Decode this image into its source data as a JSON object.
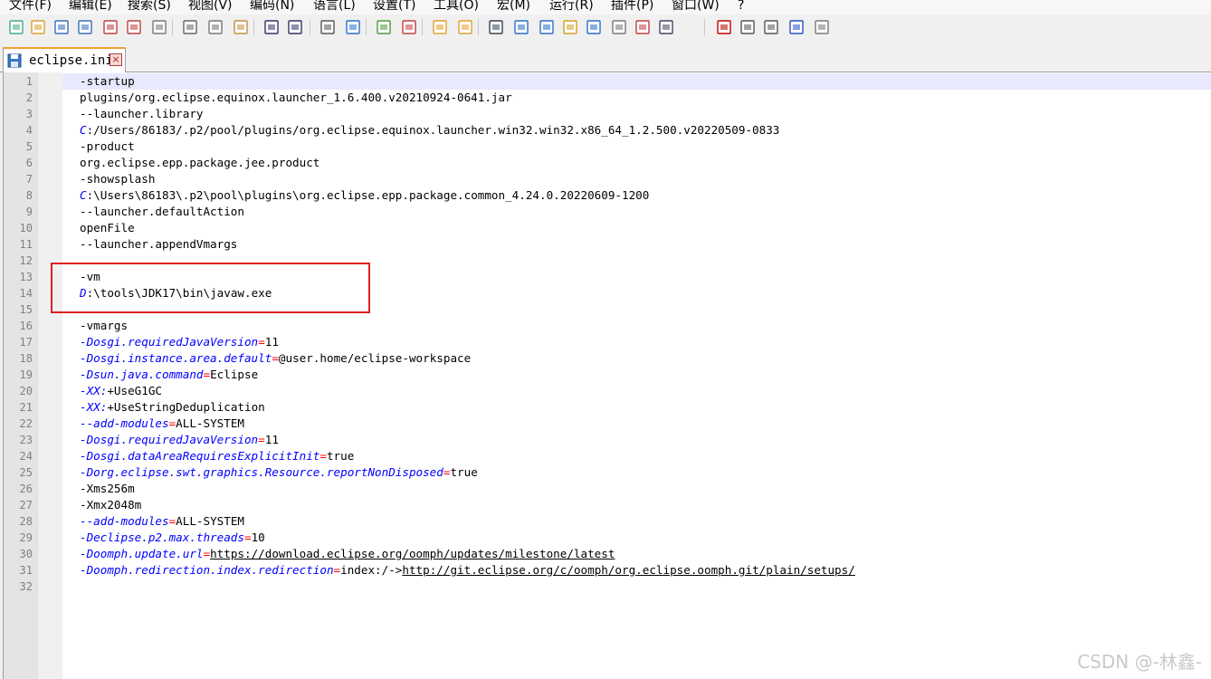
{
  "menu": [
    "文件(F)",
    "编辑(E)",
    "搜索(S)",
    "视图(V)",
    "编码(N)",
    "语言(L)",
    "设置(T)",
    "工具(O)",
    "宏(M)",
    "运行(R)",
    "插件(P)",
    "窗口(W)",
    "?"
  ],
  "toolbar": {
    "icons": [
      "new-file-icon",
      "open-file-icon",
      "save-icon",
      "save-all-icon",
      "close-icon",
      "close-all-icon",
      "print-icon",
      "cut-icon",
      "copy-icon",
      "paste-icon",
      "undo-icon",
      "redo-icon",
      "find-icon",
      "replace-icon",
      "zoom-in-icon",
      "zoom-out-icon",
      "sync-vertical-icon",
      "sync-horizontal-icon",
      "word-wrap-icon",
      "show-all-chars-icon",
      "indent-guide-icon",
      "user-language-icon",
      "document-map-icon",
      "function-list-icon",
      "folder-workspace-icon",
      "monitor-icon",
      "record-macro-icon",
      "stop-record-icon",
      "play-macro-icon",
      "run-macro-multiple-icon",
      "save-macro-icon"
    ]
  },
  "tab": {
    "label": "eclipse.ini",
    "close": "×"
  },
  "lines": [
    [
      {
        "t": "-startup"
      }
    ],
    [
      {
        "t": "plugins/org.eclipse.equinox.launcher_1.6.400.v20210924-0641.jar"
      }
    ],
    [
      {
        "t": "--launcher.library"
      }
    ],
    [
      {
        "t": "C",
        "s": "drv"
      },
      {
        "t": ":/Users/86183/.p2/pool/plugins/org.eclipse.equinox.launcher.win32.win32.x86_64_1.2.500.v20220509-0833"
      }
    ],
    [
      {
        "t": "-product"
      }
    ],
    [
      {
        "t": "org.eclipse.epp.package.jee.product"
      }
    ],
    [
      {
        "t": "-showsplash"
      }
    ],
    [
      {
        "t": "C",
        "s": "drv"
      },
      {
        "t": ":\\Users\\86183\\.p2\\pool\\plugins\\org.eclipse.epp.package.common_4.24.0.20220609-1200"
      }
    ],
    [
      {
        "t": "--launcher.defaultAction"
      }
    ],
    [
      {
        "t": "openFile"
      }
    ],
    [
      {
        "t": "--launcher.appendVmargs"
      }
    ],
    [],
    [
      {
        "t": "-vm"
      }
    ],
    [
      {
        "t": "D",
        "s": "drv"
      },
      {
        "t": ":\\tools\\JDK17\\bin\\javaw.exe"
      }
    ],
    [],
    [
      {
        "t": "-vmargs"
      }
    ],
    [
      {
        "t": "-Dosgi.requiredJavaVersion",
        "s": "key"
      },
      {
        "t": "=",
        "s": "eq"
      },
      {
        "t": "11"
      }
    ],
    [
      {
        "t": "-Dosgi.instance.area.default",
        "s": "key"
      },
      {
        "t": "=",
        "s": "eq"
      },
      {
        "t": "@user.home/eclipse-workspace"
      }
    ],
    [
      {
        "t": "-Dsun.java.command",
        "s": "key"
      },
      {
        "t": "=",
        "s": "eq"
      },
      {
        "t": "Eclipse"
      }
    ],
    [
      {
        "t": "-XX:",
        "s": "key"
      },
      {
        "t": "+UseG1GC"
      }
    ],
    [
      {
        "t": "-XX:",
        "s": "key"
      },
      {
        "t": "+UseStringDeduplication"
      }
    ],
    [
      {
        "t": "--add-modules",
        "s": "key"
      },
      {
        "t": "=",
        "s": "eq"
      },
      {
        "t": "ALL-SYSTEM"
      }
    ],
    [
      {
        "t": "-Dosgi.requiredJavaVersion",
        "s": "key"
      },
      {
        "t": "=",
        "s": "eq"
      },
      {
        "t": "11"
      }
    ],
    [
      {
        "t": "-Dosgi.dataAreaRequiresExplicitInit",
        "s": "key"
      },
      {
        "t": "=",
        "s": "eq"
      },
      {
        "t": "true"
      }
    ],
    [
      {
        "t": "-Dorg.eclipse.swt.graphics.Resource.reportNonDisposed",
        "s": "key"
      },
      {
        "t": "=",
        "s": "eq"
      },
      {
        "t": "true"
      }
    ],
    [
      {
        "t": "-Xms256m"
      }
    ],
    [
      {
        "t": "-Xmx2048m"
      }
    ],
    [
      {
        "t": "--add-modules",
        "s": "key"
      },
      {
        "t": "=",
        "s": "eq"
      },
      {
        "t": "ALL-SYSTEM"
      }
    ],
    [
      {
        "t": "-Declipse.p2.max.threads",
        "s": "key"
      },
      {
        "t": "=",
        "s": "eq"
      },
      {
        "t": "10"
      }
    ],
    [
      {
        "t": "-Doomph.update.url",
        "s": "key"
      },
      {
        "t": "=",
        "s": "eq"
      },
      {
        "t": "https://download.eclipse.org/oomph/updates/milestone/latest",
        "s": "url"
      }
    ],
    [
      {
        "t": "-Doomph.redirection.index.redirection",
        "s": "key"
      },
      {
        "t": "=",
        "s": "eq"
      },
      {
        "t": "index:/->"
      },
      {
        "t": "http://git.eclipse.org/c/oomph/org.eclipse.oomph.git/plain/setups/",
        "s": "url"
      }
    ],
    []
  ],
  "watermark": "CSDN @-林鑫-"
}
